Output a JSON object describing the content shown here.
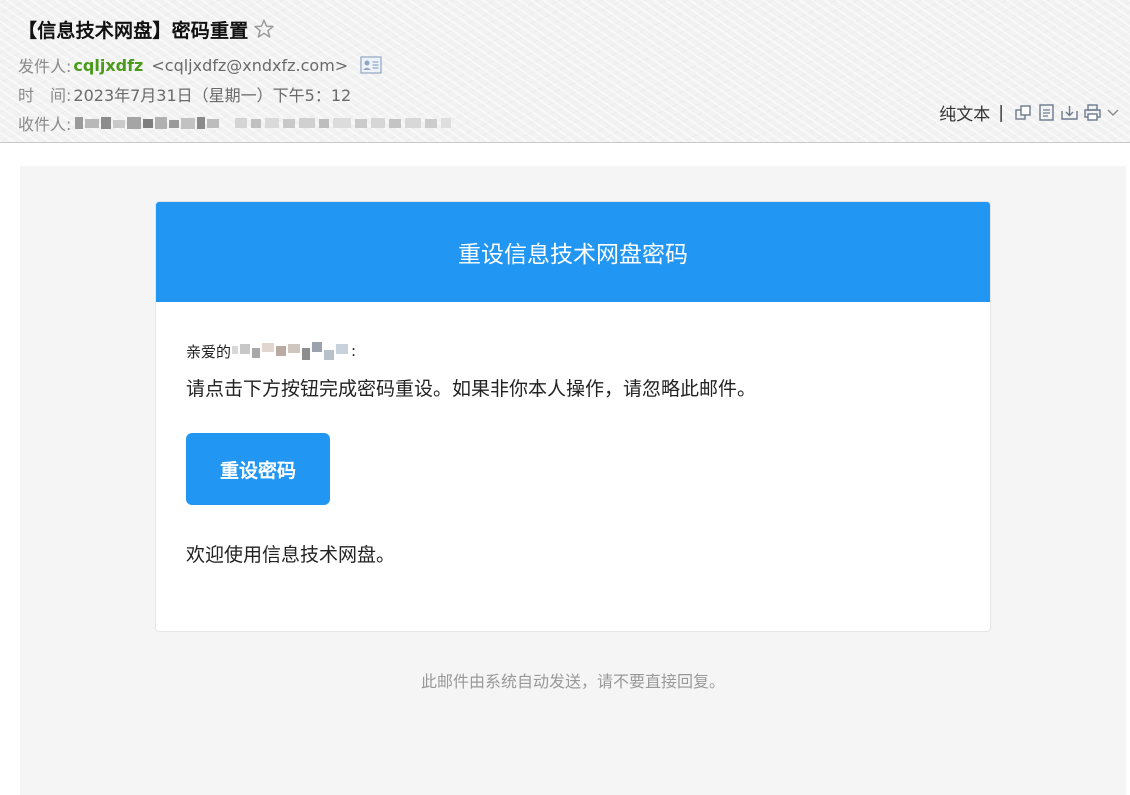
{
  "header": {
    "subject": "【信息技术网盘】密码重置",
    "sender": {
      "label": "发件人:",
      "name": "cqljxdfz",
      "address": "<cqljxdfz@xndxfz.com>"
    },
    "time": {
      "label": "时　间:",
      "value": "2023年7月31日（星期一）下午5：12"
    },
    "recipient": {
      "label": "收件人:"
    },
    "toolbar": {
      "plain_text_label": "纯文本",
      "separator": "|"
    }
  },
  "email": {
    "banner_title": "重设信息技术网盘密码",
    "greeting_prefix": "亲爱的",
    "greeting_suffix": ":",
    "instruction": "请点击下方按钮完成密码重设。如果非你本人操作，请忽略此邮件。",
    "button_label": "重设密码",
    "welcome": "欢迎使用信息技术网盘。",
    "footer": "此邮件由系统自动发送，请不要直接回复。"
  },
  "colors": {
    "accent": "#2196f3",
    "sender_name": "#4a9a1c",
    "body_background": "#f5f5f5"
  },
  "icons": [
    "star-icon",
    "contact-card-icon",
    "new-window-icon",
    "note-icon",
    "download-icon",
    "print-icon",
    "chevron-down-icon"
  ]
}
